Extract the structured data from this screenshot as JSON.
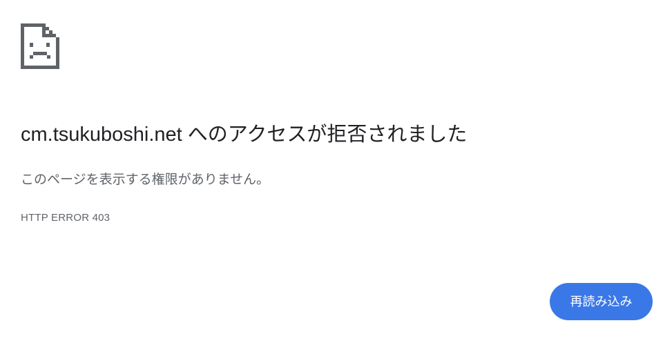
{
  "error_page": {
    "icon": "sad-page-icon",
    "heading_domain": "cm.tsukuboshi.net",
    "heading_suffix": " へのアクセスが拒否されました",
    "message": "このページを表示する権限がありません。",
    "error_code": "HTTP ERROR 403",
    "reload_label": "再読み込み"
  },
  "colors": {
    "accent": "#3b78e7",
    "heading": "#202124",
    "secondary_text": "#5f6368",
    "icon": "#5f6368"
  }
}
